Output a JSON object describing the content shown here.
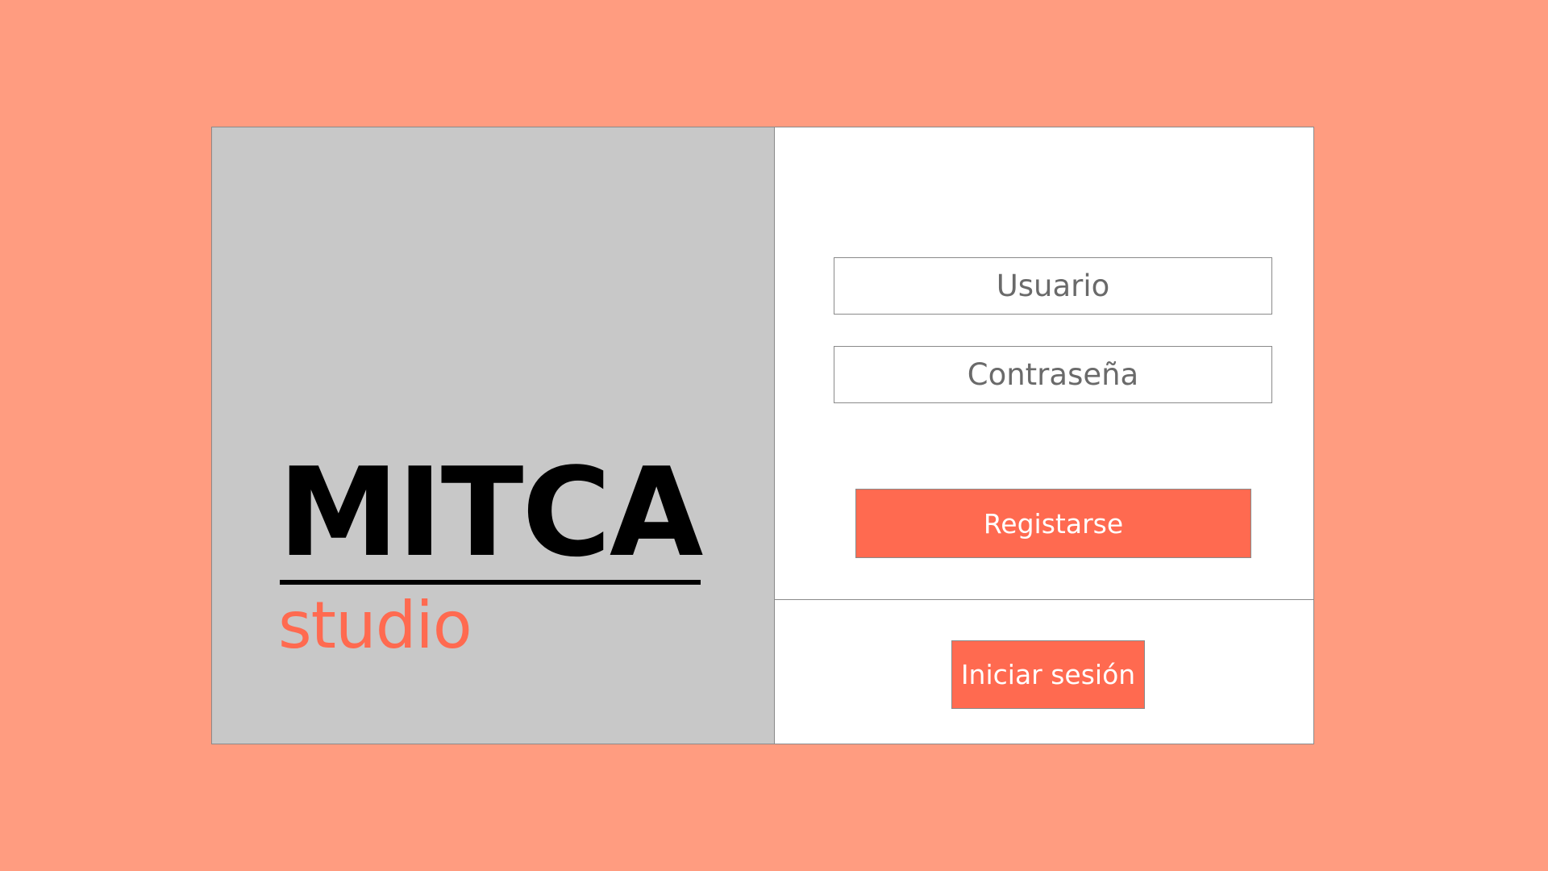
{
  "brand": {
    "name": "MITCA",
    "tagline": "studio"
  },
  "form": {
    "username_placeholder": "Usuario",
    "password_placeholder": "Contraseña",
    "register_label": "Registarse"
  },
  "login": {
    "login_label": "Iniciar sesión"
  },
  "colors": {
    "background": "#FF9C80",
    "accent": "#FF6A50",
    "brand_panel": "#C8C8C8"
  }
}
